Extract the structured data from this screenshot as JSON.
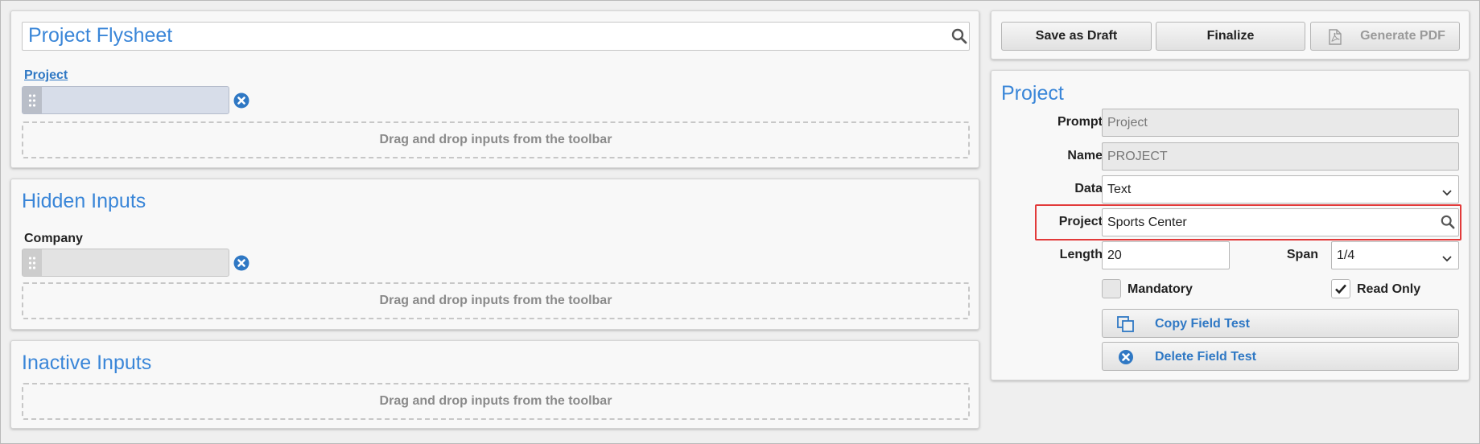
{
  "flysheet": {
    "title_value": "Project Flysheet",
    "field_label": "Project",
    "dropzone_text": "Drag and drop inputs from the toolbar"
  },
  "hidden_section": {
    "heading": "Hidden Inputs",
    "field_label": "Company",
    "dropzone_text": "Drag and drop inputs from the toolbar"
  },
  "inactive_section": {
    "heading": "Inactive Inputs",
    "dropzone_text": "Drag and drop inputs from the toolbar"
  },
  "toolbar": {
    "save_draft_label": "Save as Draft",
    "finalize_label": "Finalize",
    "generate_pdf_label": "Generate PDF"
  },
  "properties": {
    "heading": "Project",
    "prompt_label": "Prompt",
    "prompt_value": "Project",
    "name_label": "Name",
    "name_value": "PROJECT",
    "data_label": "Data",
    "data_value": "Text",
    "project_label": "Project",
    "project_value": "Sports Center",
    "length_label": "Length",
    "length_value": "20",
    "span_label": "Span",
    "span_value": "1/4",
    "mandatory_label": "Mandatory",
    "mandatory_checked": false,
    "readonly_label": "Read Only",
    "readonly_checked": true,
    "copy_label": "Copy Field Test",
    "delete_label": "Delete Field Test"
  },
  "colors": {
    "accent": "#3a86d8",
    "link": "#2f78c4",
    "highlight": "#e23a3a",
    "remove_icon": "#2f78c4"
  },
  "icons": [
    "search-icon",
    "drag-handle-icon",
    "remove-icon",
    "pdf-icon",
    "chevron-down-icon",
    "checkmark-icon",
    "copy-icon",
    "delete-icon"
  ]
}
